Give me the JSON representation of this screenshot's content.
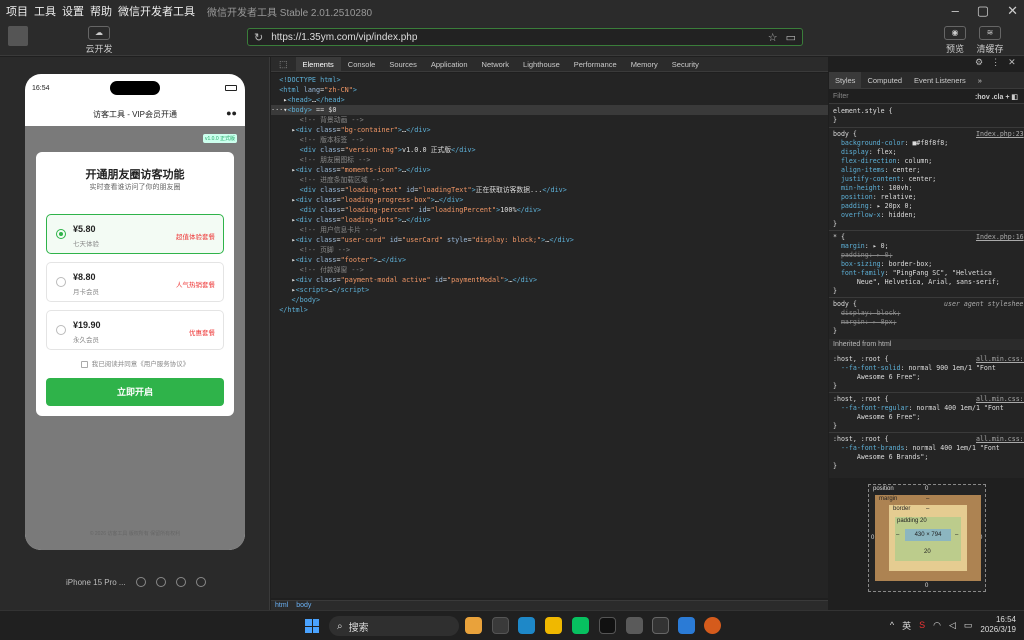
{
  "menubar": {
    "items": [
      "项目",
      "工具",
      "设置",
      "帮助",
      "微信开发者工具"
    ],
    "title": "微信开发者工具 Stable 2.01.2510280"
  },
  "toolbar": {
    "cloud_label": "云开发",
    "url": "https://1.35ym.com/vip/index.php",
    "preview_label": "预览",
    "clean_label": "清缓存"
  },
  "phone": {
    "time": "16:54",
    "nav_title": "访客工具 - VIP会员开通",
    "version_tag": "v1.0.0 正式版",
    "footer": "© 2026 访客工具 版权所有 保留所有权利",
    "modal": {
      "title": "开通朋友圈访客功能",
      "subtitle": "实时查看谁访问了你的朋友圈",
      "options": [
        {
          "price": "¥5.80",
          "name": "七天体验",
          "badge": "超值体验套餐"
        },
        {
          "price": "¥8.80",
          "name": "月卡会员",
          "badge": "人气热销套餐"
        },
        {
          "price": "¥19.90",
          "name": "永久会员",
          "badge": "优惠套餐"
        }
      ],
      "agree": "我已阅读并同意《用户服务协议》",
      "button": "立即开启"
    }
  },
  "simulator": {
    "device": "iPhone 15 Pro ..."
  },
  "devtools": {
    "tabs": [
      "Elements",
      "Console",
      "Sources",
      "Application",
      "Network",
      "Lighthouse",
      "Performance",
      "Memory",
      "Security"
    ],
    "breadcrumbs": [
      "html",
      "body"
    ]
  },
  "styles": {
    "tabs": [
      "Styles",
      "Computed",
      "Event Listeners"
    ],
    "filter_placeholder": "Filter",
    "hov": ":hov",
    "cls": ".cla",
    "inherited_label": "Inherited from html"
  },
  "boxmodel": {
    "position": "position",
    "position_val": "0",
    "margin": "margin",
    "margin_val": "–",
    "border": "border",
    "border_val": "–",
    "padding": "padding 20",
    "padding_bottom": "20",
    "content": "430 × 794",
    "outer_left": "0",
    "outer_right": "0",
    "outer_bottom": "0",
    "left_dash": "–",
    "right_dash": "–"
  },
  "taskbar": {
    "search": "搜索",
    "ime": "英",
    "time": "16:54",
    "date": "2026/3/19"
  }
}
